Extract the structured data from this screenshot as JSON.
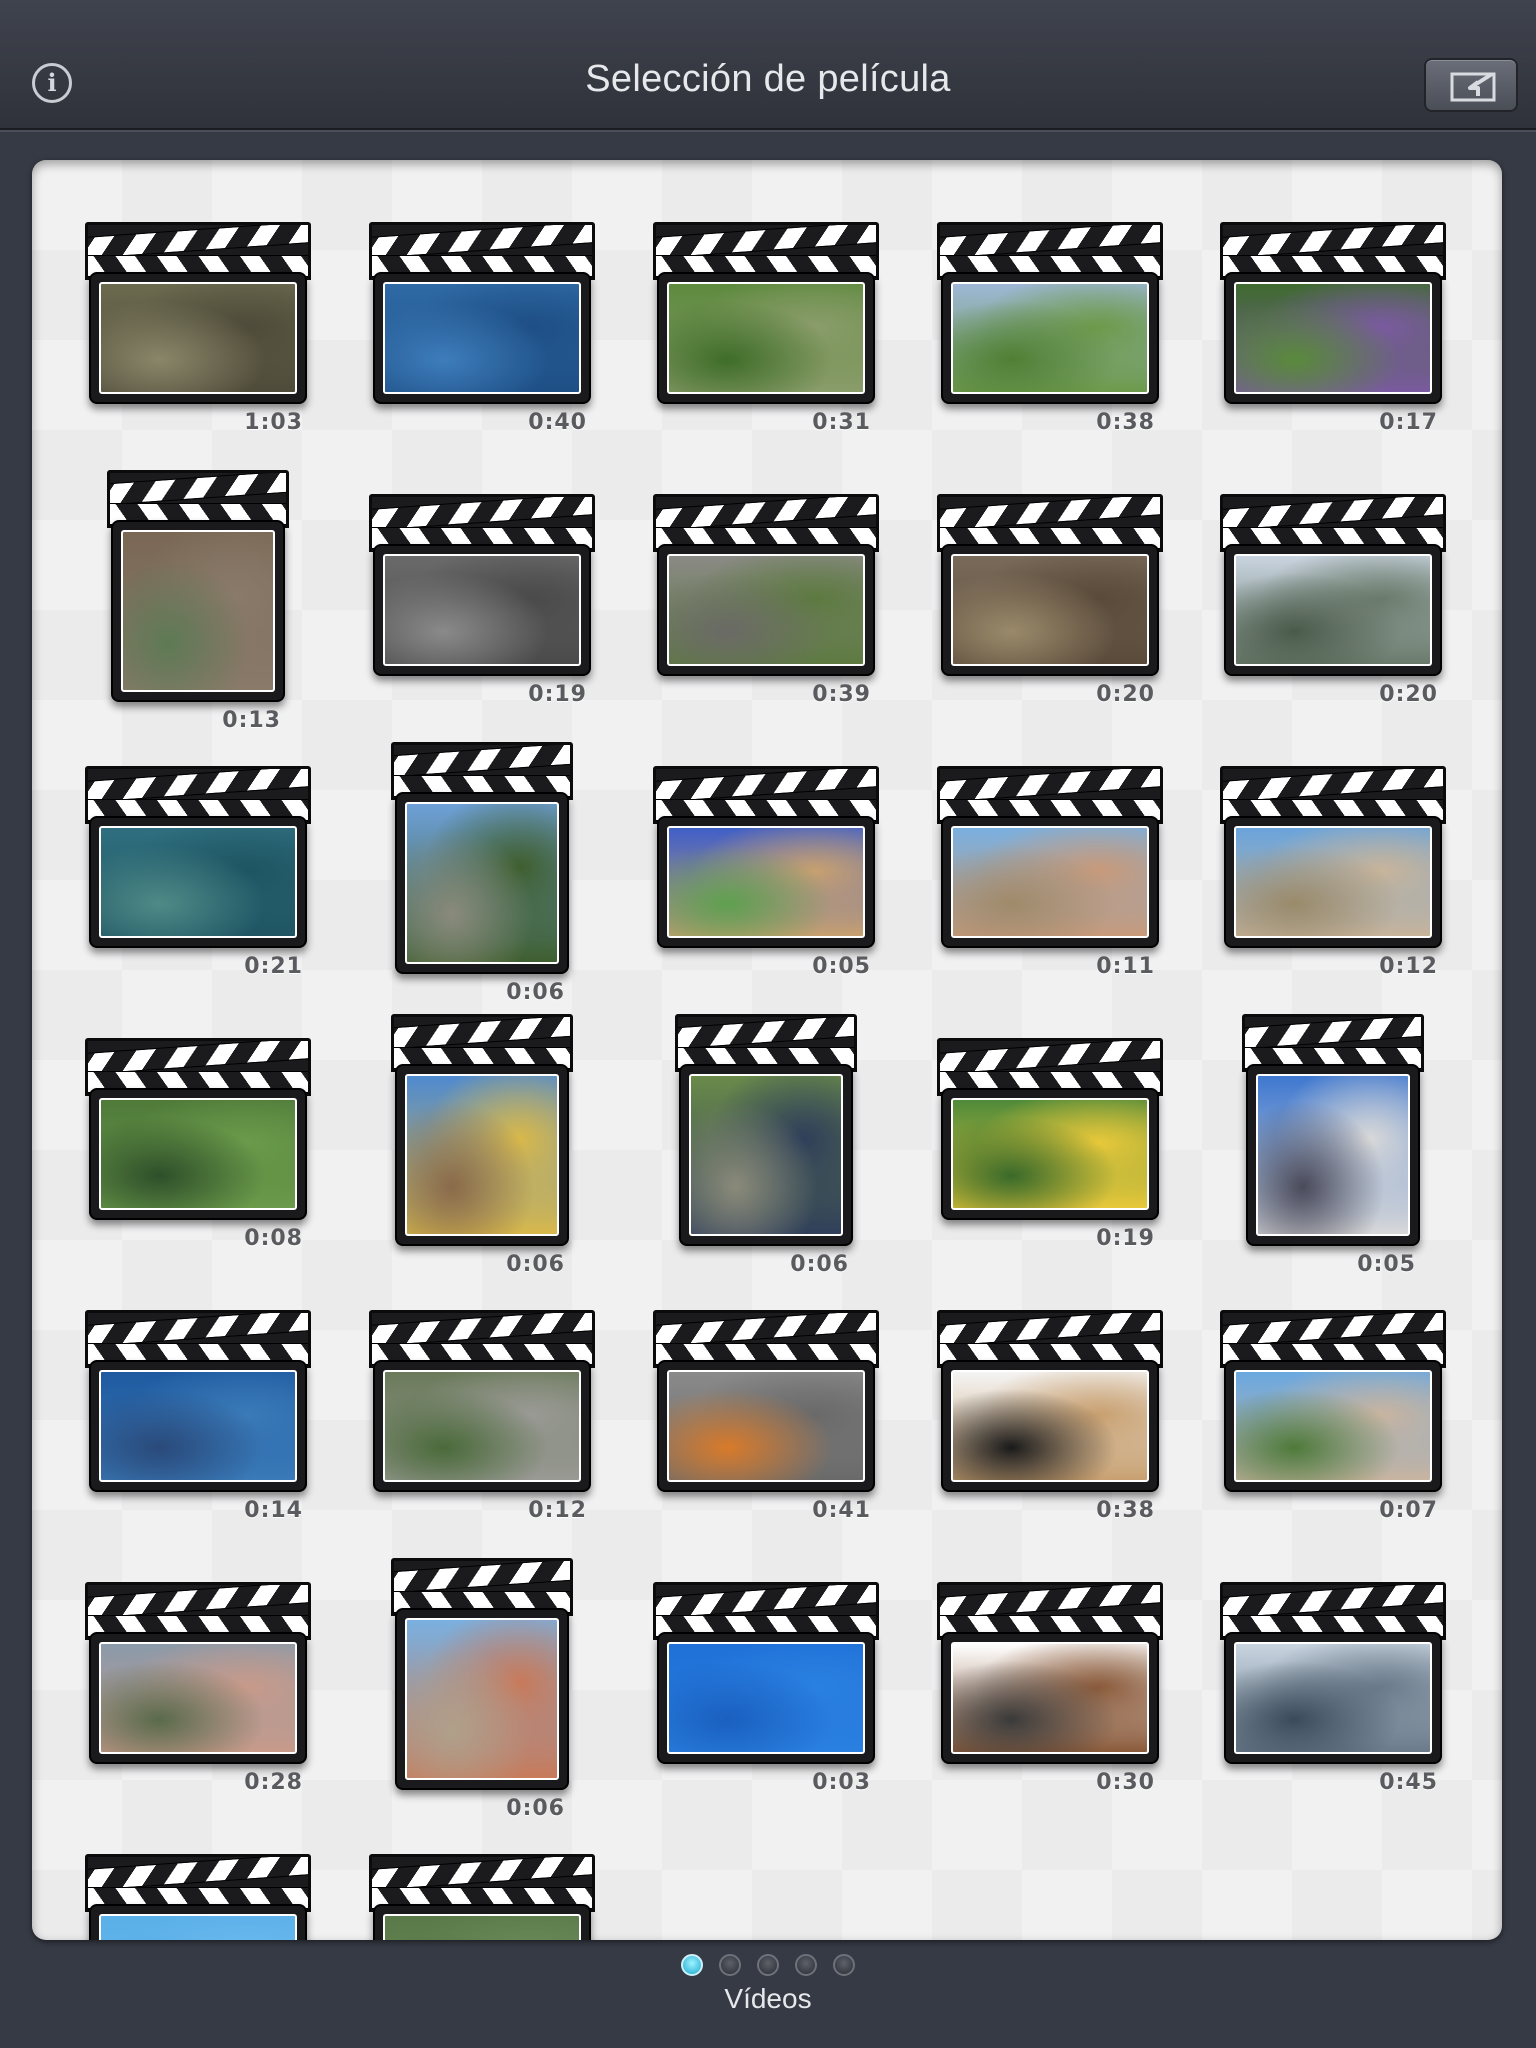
{
  "header": {
    "title": "Selección de película",
    "info_icon": "info-icon",
    "export_icon": "import-export-icon"
  },
  "pager": {
    "pages": 5,
    "active_page": 1,
    "label": "Vídeos"
  },
  "videos": [
    {
      "duration": "1:03",
      "scene": "garden-palm",
      "colors": [
        "#6b6a4e",
        "#4f4b3a",
        "#8a8669"
      ]
    },
    {
      "duration": "0:40",
      "scene": "sea",
      "colors": [
        "#2f6aa6",
        "#1e4f85",
        "#3d7cbb"
      ]
    },
    {
      "duration": "0:31",
      "scene": "picnic-lawn",
      "colors": [
        "#5d8a3e",
        "#8a9c6a",
        "#3f6d2a"
      ]
    },
    {
      "duration": "0:38",
      "scene": "football-field",
      "colors": [
        "#9db7d6",
        "#6d9a4a",
        "#507f34"
      ]
    },
    {
      "duration": "0:17",
      "scene": "butterfly-flowers",
      "colors": [
        "#3f6b2f",
        "#7a5aa0",
        "#5a8a3c"
      ]
    },
    {
      "duration": "0:13",
      "scene": "race-track",
      "colors": [
        "#7a6855",
        "#8a7a6a",
        "#5e7a55"
      ]
    },
    {
      "duration": "0:19",
      "scene": "beach-children",
      "colors": [
        "#6a6a6a",
        "#4a4a4a",
        "#8a8a8a"
      ]
    },
    {
      "duration": "0:39",
      "scene": "red-panda-rocks",
      "colors": [
        "#8a8a85",
        "#5d7a40",
        "#6a6a65"
      ]
    },
    {
      "duration": "0:20",
      "scene": "elephant-shrew",
      "colors": [
        "#7a6a5a",
        "#5a4a3a",
        "#9a8a6a"
      ]
    },
    {
      "duration": "0:20",
      "scene": "man-overlook",
      "colors": [
        "#c9d4e0",
        "#6a7a6a",
        "#4a5a4a"
      ]
    },
    {
      "duration": "0:21",
      "scene": "aquarium-fish",
      "colors": [
        "#2f6f7f",
        "#1f5563",
        "#4f8a86"
      ]
    },
    {
      "duration": "0:06",
      "scene": "pine-trees",
      "colors": [
        "#6ea0d8",
        "#3f5f2f",
        "#8a8a7a"
      ]
    },
    {
      "duration": "0:05",
      "scene": "prairie-dog",
      "colors": [
        "#3f5fc8",
        "#c8a070",
        "#5fa04f"
      ]
    },
    {
      "duration": "0:11",
      "scene": "town-rooftops",
      "colors": [
        "#7ab0e0",
        "#c89a7a",
        "#a08a6a"
      ]
    },
    {
      "duration": "0:12",
      "scene": "town-view",
      "colors": [
        "#6aa4dc",
        "#c8b49a",
        "#9a8a6a"
      ]
    },
    {
      "duration": "0:08",
      "scene": "green-plants",
      "colors": [
        "#4f7a3a",
        "#6a9a4a",
        "#2f4f2a"
      ]
    },
    {
      "duration": "0:06",
      "scene": "palm-street",
      "colors": [
        "#4f8ad0",
        "#d8b84a",
        "#8a6a4a"
      ]
    },
    {
      "duration": "0:06",
      "scene": "blue-car",
      "colors": [
        "#6a8a4a",
        "#2f3f5a",
        "#8a8a7a"
      ]
    },
    {
      "duration": "0:19",
      "scene": "butterfly-leaves",
      "colors": [
        "#4f8a3a",
        "#e8c83a",
        "#3a6a2a"
      ]
    },
    {
      "duration": "0:05",
      "scene": "parking-lot",
      "colors": [
        "#3f78d0",
        "#d8d8d8",
        "#4a4a5a"
      ]
    },
    {
      "duration": "0:14",
      "scene": "turtle-aquarium",
      "colors": [
        "#1f5aa0",
        "#3a7ab8",
        "#2a4a7a"
      ]
    },
    {
      "duration": "0:12",
      "scene": "red-panda-zoo",
      "colors": [
        "#6a7a5a",
        "#9a9a95",
        "#4a6a3a"
      ]
    },
    {
      "duration": "0:41",
      "scene": "kids-street",
      "colors": [
        "#8a8a8a",
        "#6a6a6a",
        "#d87a2a"
      ]
    },
    {
      "duration": "0:38",
      "scene": "origami-crane",
      "colors": [
        "#f4f4f4",
        "#c8a070",
        "#1a1a1a"
      ]
    },
    {
      "duration": "0:07",
      "scene": "coastal-town",
      "colors": [
        "#6aa8e0",
        "#c8b4a0",
        "#4f7a3a"
      ]
    },
    {
      "duration": "0:28",
      "scene": "balcony-view",
      "colors": [
        "#8a9aaa",
        "#c89a8a",
        "#5a6a4a"
      ]
    },
    {
      "duration": "0:06",
      "scene": "palm-rooftop",
      "colors": [
        "#7ab0e0",
        "#c87a5a",
        "#b0a08a"
      ]
    },
    {
      "duration": "0:03",
      "scene": "blue-sea",
      "colors": [
        "#1f70d8",
        "#2a80e0",
        "#1a60c0"
      ]
    },
    {
      "duration": "0:30",
      "scene": "spaniel-dog",
      "colors": [
        "#ffffff",
        "#8a5a3a",
        "#3a3a3a"
      ]
    },
    {
      "duration": "0:45",
      "scene": "lake-swans",
      "colors": [
        "#c8d4e0",
        "#6a7a8a",
        "#3a4a5a"
      ]
    },
    {
      "duration": "",
      "scene": "partial-sky",
      "colors": [
        "#5ab0e8",
        "#6ab8ee",
        "#4aa0e0"
      ]
    },
    {
      "duration": "",
      "scene": "partial-garden",
      "colors": [
        "#5a7a4a",
        "#6a8a5a",
        "#4a6a3a"
      ]
    }
  ]
}
